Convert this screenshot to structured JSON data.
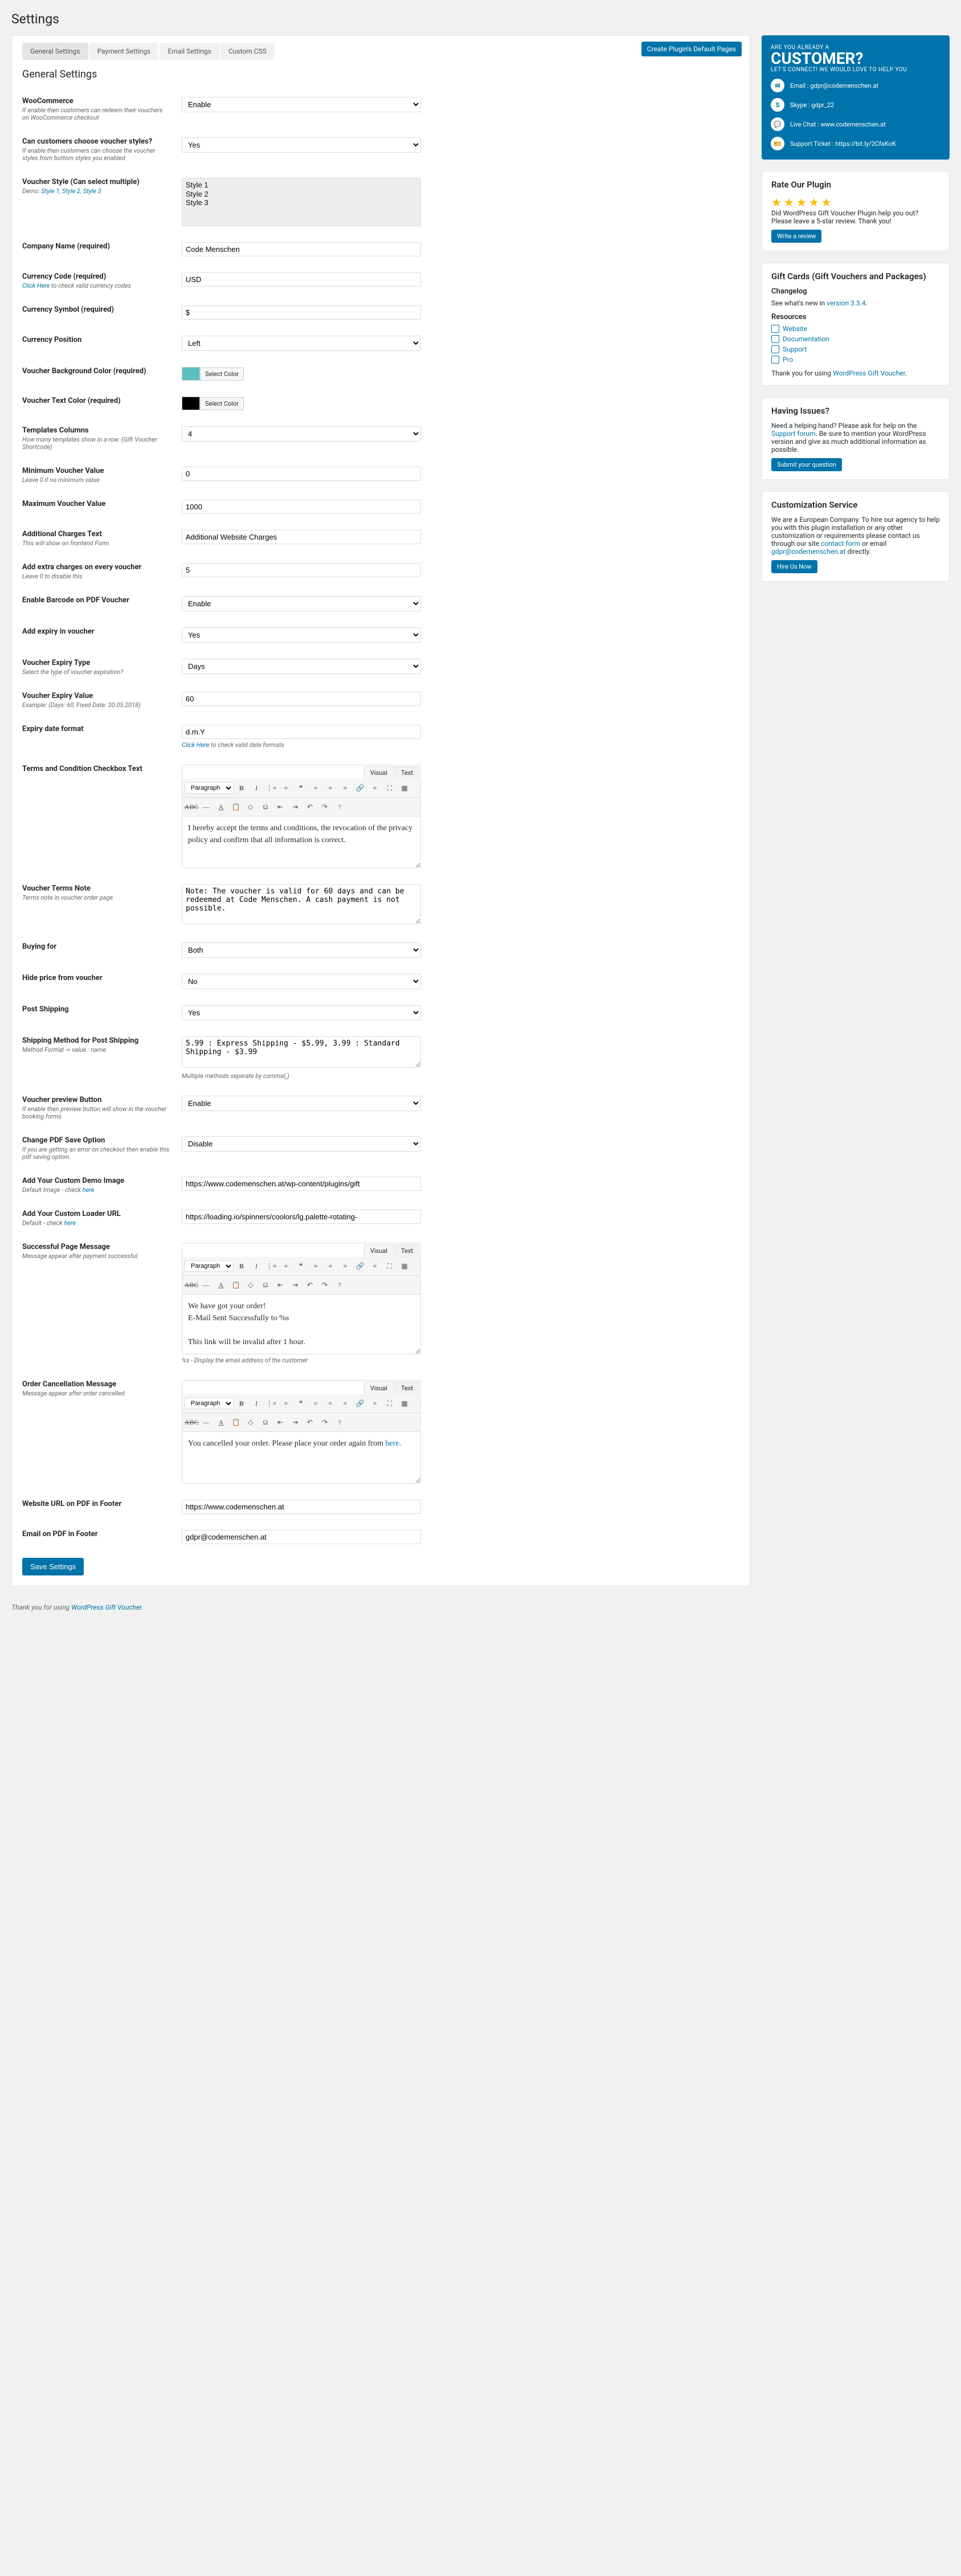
{
  "page_title": "Settings",
  "create_btn": "Create Plugin's Default Pages",
  "tabs": [
    "General Settings",
    "Payment Settings",
    "Email Settings",
    "Custom CSS"
  ],
  "section_title": "General Settings",
  "rows": {
    "woo": {
      "label": "WooCommerce",
      "desc": "If enable then customers can redeem their vouchers on WooCommerce checkout",
      "value": "Enable"
    },
    "choose_styles": {
      "label": "Can customers choose voucher styles?",
      "desc": "If enable then customers can choose the voucher styles from bottom styles you enabled",
      "value": "Yes"
    },
    "voucher_style": {
      "label": "Voucher Style (Can select multiple)",
      "desc": "Demo:",
      "links": [
        "Style 1",
        "Style 2",
        "Style 3"
      ],
      "options": [
        "Style 1",
        "Style 2",
        "Style 3"
      ]
    },
    "company": {
      "label": "Company Name (required)",
      "value": "Code Menschen"
    },
    "currency_code": {
      "label": "Currency Code (required)",
      "desc_link": "Click Here",
      "desc_after": " to check valid currency codes",
      "value": "USD"
    },
    "currency_symbol": {
      "label": "Currency Symbol (required)",
      "value": "$"
    },
    "currency_position": {
      "label": "Currency Position",
      "value": "Left"
    },
    "bg_color": {
      "label": "Voucher Background Color (required)",
      "value": "#5bc0c0",
      "btn": "Select Color"
    },
    "text_color": {
      "label": "Voucher Text Color (required)",
      "value": "#000000",
      "btn": "Select Color"
    },
    "columns": {
      "label": "Templates Columns",
      "desc": "How many templates show in a row. (Gift Voucher Shortcode)",
      "value": "4"
    },
    "min_value": {
      "label": "Minimum Voucher Value",
      "desc": "Leave 0 if no minimum value",
      "value": "0"
    },
    "max_value": {
      "label": "Maximum Voucher Value",
      "value": "1000"
    },
    "charges_text": {
      "label": "Additional Charges Text",
      "desc": "This will show on frontend Form",
      "value": "Additional Website Charges"
    },
    "extra_charges": {
      "label": "Add extra charges on every voucher",
      "desc": "Leave 0 to disable this",
      "value": "5"
    },
    "barcode": {
      "label": "Enable Barcode on PDF Voucher",
      "value": "Enable"
    },
    "add_expiry": {
      "label": "Add expiry in voucher",
      "value": "Yes"
    },
    "expiry_type": {
      "label": "Voucher Expiry Type",
      "desc": "Select the type of voucher expiration?",
      "value": "Days"
    },
    "expiry_value": {
      "label": "Voucher Expiry Value",
      "desc": "Example: (Days: 60, Fixed Date: 20.05.2018)",
      "value": "60"
    },
    "date_format": {
      "label": "Expiry date format",
      "value": "d.m.Y",
      "note_link": "Click Here",
      "note_after": " to check valid date formats"
    },
    "terms_checkbox": {
      "label": "Terms and Condition Checkbox Text",
      "value": "I hereby accept the terms and conditions, the revocation of the privacy policy and confirm that all information is correct."
    },
    "terms_note": {
      "label": "Voucher Terms Note",
      "desc": "Terms note in voucher order page",
      "value": "Note: The voucher is valid for 60 days and can be redeemed at Code Menschen. A cash payment is not possible."
    },
    "buying_for": {
      "label": "Buying for",
      "value": "Both"
    },
    "hide_price": {
      "label": "Hide price from voucher",
      "value": "No"
    },
    "post_shipping": {
      "label": "Post Shipping",
      "value": "Yes"
    },
    "shipping_method": {
      "label": "Shipping Method for Post Shipping",
      "desc": "Method Format -> value : name",
      "value": "5.99 : Express Shipping - $5.99, 3.99 : Standard Shipping - $3.99",
      "note": "Multiple methods seperate by comma(,)"
    },
    "preview_btn": {
      "label": "Voucher preview Button",
      "desc": "If enable then preview button will show in the voucher booking forms",
      "value": "Enable"
    },
    "pdf_save": {
      "label": "Change PDF Save Option",
      "desc": "If you are getting an error on checkout then enable this pdf saving option.",
      "value": "Disable"
    },
    "demo_image": {
      "label": "Add Your Custom Demo Image",
      "desc": "Default Image - check ",
      "desc_link": "here",
      "value": "https://www.codemenschen.at/wp-content/plugins/gift"
    },
    "loader_url": {
      "label": "Add Your Custom Loader URL",
      "desc": "Default - check ",
      "desc_link": "here",
      "value": "https://loading.io/spinners/coolors/lg.palette-rotating-"
    },
    "success_msg": {
      "label": "Successful Page Message",
      "desc": "Message appear after payment successful.",
      "line1": "We have got your order!",
      "line2": "E-Mail Sent Successfully to %s",
      "line3": "This link will be invalid after 1 hour.",
      "note": "%s - Display the email address of the customer"
    },
    "cancel_msg": {
      "label": "Order Cancellation Message",
      "desc": "Message appear after order cancelled",
      "value": "You cancelled your order. Please place your order again from ",
      "link": "here"
    },
    "website_url": {
      "label": "Website URL on PDF in Footer",
      "value": "https://www.codemenschen.at"
    },
    "email_footer": {
      "label": "Email on PDF in Footer",
      "value": "gdpr@codemenschen.at"
    }
  },
  "save": "Save Settings",
  "editor": {
    "paragraph": "Paragraph",
    "visual": "Visual",
    "text": "Text"
  },
  "sidebar": {
    "customer": {
      "q": "ARE YOU ALREADY A",
      "big": "CUSTOMER?",
      "sub": "LET'S CONNECT! WE WOULD LOVE TO HELP YOU",
      "email": "Email : gdpr@codemenschen.at",
      "skype": "Skype : gdpr_22",
      "chat": "Live Chat : www.codemenschen.at",
      "ticket": "Support Ticket : https://bit.ly/2CfaKoK"
    },
    "rate": {
      "title": "Rate Our Plugin",
      "text": "Did WordPress Gift Voucher Plugin help you out? Please leave a 5-star review. Thank you!",
      "btn": "Write a review"
    },
    "gift": {
      "title": "Gift Cards (Gift Vouchers and Packages)",
      "changelog": "Changelog",
      "see": "See what's new in ",
      "ver": "version 3.3.4",
      "resources": "Resources",
      "links": [
        "Website",
        "Documentation",
        "Support",
        "Pro"
      ],
      "thanks": "Thank you for using ",
      "thanks_link": "WordPress Gift Voucher"
    },
    "issues": {
      "title": "Having Issues?",
      "text1": "Need a helping hand? Please ask for help on the ",
      "link": "Support forum",
      "text2": ". Be sure to mention your WordPress version and give as much additional information as possible.",
      "btn": "Submit your question"
    },
    "custom": {
      "title": "Customization Service",
      "text1": "We are a European Company. To hire our agency to help you with this plugin installation or any other customization or requirements please contact us through our site ",
      "link1": "contact form",
      "text2": " or email ",
      "link2": "gdpr@codemenschen.at",
      "text3": " directly.",
      "btn": "Hire Us Now"
    }
  },
  "footer": {
    "text": "Thank you for using ",
    "link": "WordPress Gift Voucher"
  }
}
